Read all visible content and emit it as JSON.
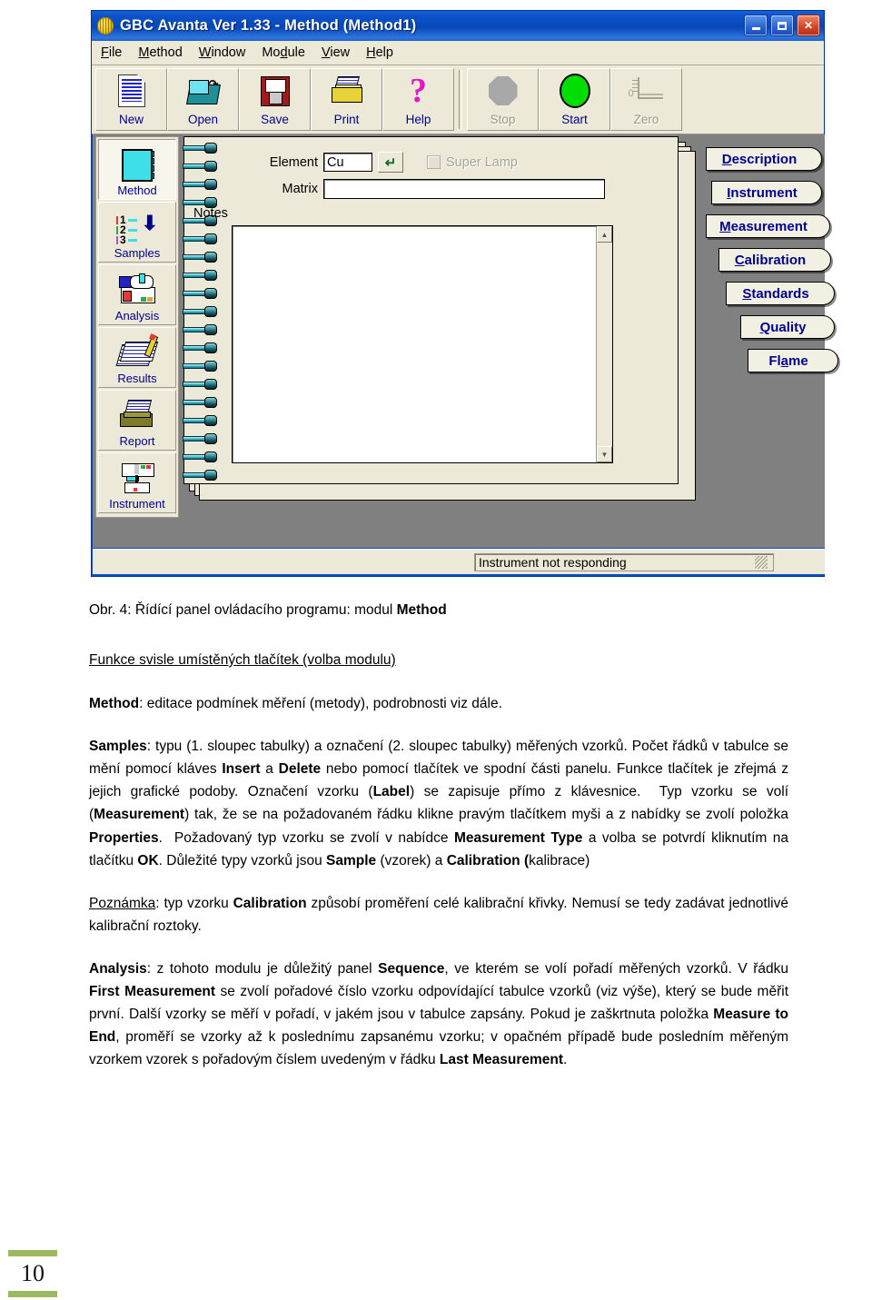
{
  "window": {
    "title": "GBC Avanta Ver 1.33 - Method (Method1)",
    "logo_icon": "app-logo-icon",
    "buttons": {
      "minimize": "_",
      "maximize": "□",
      "close": "✕"
    }
  },
  "menubar": {
    "items": [
      {
        "label": "File",
        "accel": "F"
      },
      {
        "label": "Method",
        "accel": "M"
      },
      {
        "label": "Window",
        "accel": "W"
      },
      {
        "label": "Module",
        "accel": "d"
      },
      {
        "label": "View",
        "accel": "V"
      },
      {
        "label": "Help",
        "accel": "H"
      }
    ]
  },
  "toolbar": {
    "buttons": [
      {
        "label": "New",
        "icon": "new-document-icon",
        "enabled": true
      },
      {
        "label": "Open",
        "icon": "open-folder-icon",
        "enabled": true
      },
      {
        "label": "Save",
        "icon": "floppy-disk-icon",
        "enabled": true
      },
      {
        "label": "Print",
        "icon": "printer-icon",
        "enabled": true
      },
      {
        "label": "Help",
        "icon": "question-mark-icon",
        "enabled": true
      },
      {
        "label": "Stop",
        "icon": "octagon-stop-icon",
        "enabled": false
      },
      {
        "label": "Start",
        "icon": "green-circle-icon",
        "enabled": true
      },
      {
        "label": "Zero",
        "icon": "zero-baseline-icon",
        "enabled": false
      }
    ]
  },
  "modulebar": {
    "items": [
      {
        "label": "Method",
        "icon": "method-notebook-icon",
        "selected": true
      },
      {
        "label": "Samples",
        "icon": "samples-list-icon",
        "selected": false
      },
      {
        "label": "Analysis",
        "icon": "analysis-hand-icon",
        "selected": false
      },
      {
        "label": "Results",
        "icon": "results-pencil-icon",
        "selected": false
      },
      {
        "label": "Report",
        "icon": "report-printer-icon",
        "selected": false
      },
      {
        "label": "Instrument",
        "icon": "instrument-icon",
        "selected": false
      }
    ],
    "samples_rows": [
      "1",
      "2",
      "3"
    ]
  },
  "form": {
    "element_label": "Element",
    "element_value": "Cu",
    "element_enter_icon": "enter-arrow-icon",
    "matrix_label": "Matrix",
    "matrix_value": "",
    "matrix_placeholder": "",
    "super_lamp_label": "Super Lamp",
    "super_lamp_checked": false,
    "notes_label": "Notes",
    "notes_value": "",
    "scroll_up_icon": "scroll-up-arrow-icon",
    "scroll_down_icon": "scroll-down-arrow-icon"
  },
  "tabs": [
    {
      "label": "Description",
      "accel": "D"
    },
    {
      "label": "Instrument",
      "accel": "I"
    },
    {
      "label": "Measurement",
      "accel": "M"
    },
    {
      "label": "Calibration",
      "accel": "C"
    },
    {
      "label": "Standards",
      "accel": "S"
    },
    {
      "label": "Quality",
      "accel": "Q"
    },
    {
      "label": "Flame",
      "accel": "a"
    }
  ],
  "statusbar": {
    "message": "Instrument not responding",
    "grip_icon": "resize-grip-icon"
  },
  "document": {
    "caption_prefix": "Obr. 4: Řídící panel ovládacího programu: modul ",
    "caption_bold": "Method",
    "section_heading": "Funkce svisle umístěných tlačítek (volba modulu)",
    "method_term": "Method",
    "method_text": ": editace podmínek měření (metody), podrobnosti viz dále.",
    "samples_term": "Samples",
    "samples_text": ": typu (1. sloupec tabulky) a označení (2. sloupec tabulky) měřených vzorků. Počet řádků v tabulce se mění pomocí kláves Insert a Delete nebo pomocí tlačítek ve spodní části panelu. Funkce tlačítek je zřejmá z jejich grafické podoby. Označení vzorku (Label) se zapisuje přímo z klávesnice. Typ vzorku se volí (Measurement) tak, že se na požadovaném řádku klikne pravým tlačítkem myši a z nabídky se zvolí položka Properties. Požadovaný typ vzorku se zvolí v nabídce Measurement Type a volba se potvrdí kliknutím na tlačítku OK. Důležité typy vzorků jsou Sample (vzorek) a Calibration (kalibrace)",
    "note_term": "Poznámka",
    "note_text": ": typ vzorku Calibration způsobí proměření celé kalibrační křivky. Nemusí se tedy zadávat jednotlivé kalibrační roztoky.",
    "analysis_term": "Analysis",
    "analysis_text": ": z tohoto modulu je důležitý panel Sequence, ve kterém se volí pořadí měřených vzorků. V řádku First Measurement se zvolí pořadové číslo vzorku odpovídající tabulce vzorků (viz výše), který se bude měřit první. Další vzorky se měří v pořadí, v jakém jsou v tabulce zapsány. Pokud je zaškrtnuta položka Measure to End, proměří se vzorky až k poslednímu zapsanému vzorku; v opačném případě bude posledním měřeným vzorkem vzorek s pořadovým číslem uvedeným v řádku Last Measurement.",
    "page_number": "10"
  }
}
